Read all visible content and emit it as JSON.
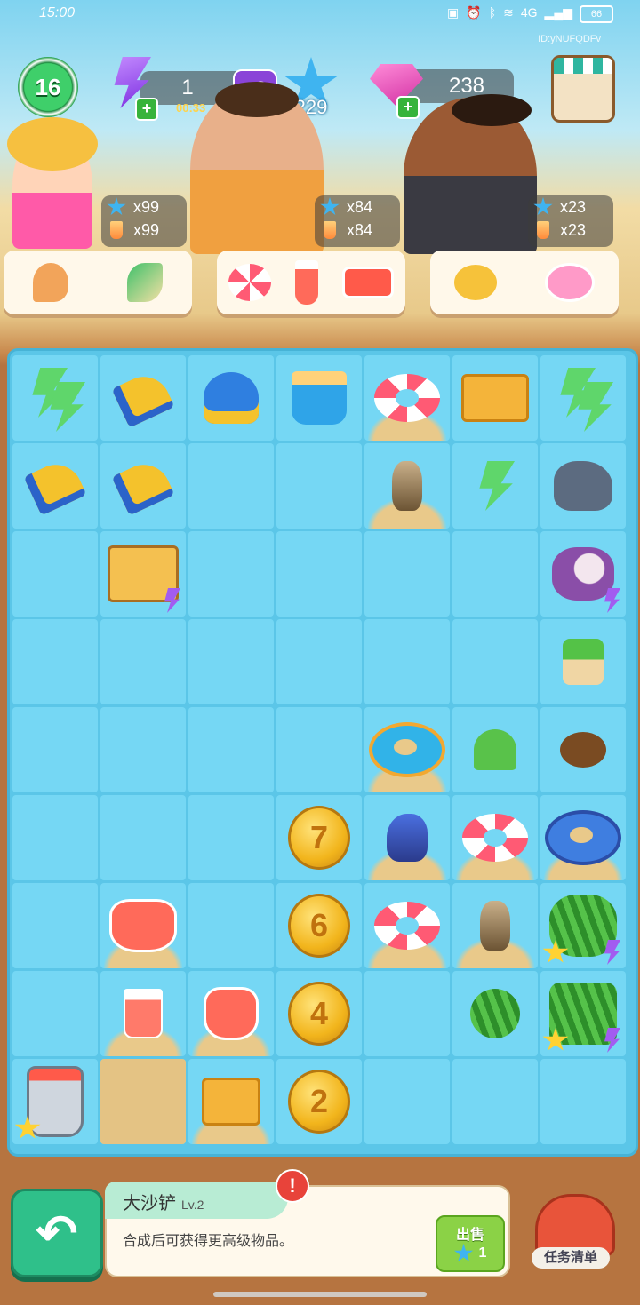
{
  "status_bar": {
    "time": "15:00",
    "battery": "66",
    "network": "4G"
  },
  "player_id": "ID:yNUFQDFv",
  "top_bar": {
    "level": "16",
    "energy": "1",
    "energy_timer": "00:33",
    "multiplier": "×2",
    "stars": "229",
    "gems": "238"
  },
  "customers": [
    {
      "name": "woman-customer",
      "star_count": "x99",
      "drink_count": "x99",
      "order_items": [
        "conch-shell-icon",
        "green-shell-icon"
      ]
    },
    {
      "name": "chef-customer",
      "star_count": "x84",
      "drink_count": "x84",
      "order_items": [
        "swim-ring-icon",
        "juice-glass-icon",
        "watermelon-plate-icon"
      ]
    },
    {
      "name": "businessman-customer",
      "star_count": "x23",
      "drink_count": "x23",
      "order_items": [
        "duck-float-icon",
        "donut-float-icon"
      ]
    }
  ],
  "board": {
    "rows": 9,
    "cols": 7,
    "coins": [
      "7",
      "6",
      "4",
      "2"
    ]
  },
  "item_info": {
    "name": "大沙铲",
    "level": "Lv.2",
    "description": "合成后可获得更高级物品。",
    "sell_label": "出售",
    "sell_price": "1"
  },
  "task_list_label": "任务清单",
  "colors": {
    "board": "#5bc6e8",
    "cell": "#75d7f4",
    "sand": "#e4c384",
    "accent_green": "#2fc08a"
  }
}
